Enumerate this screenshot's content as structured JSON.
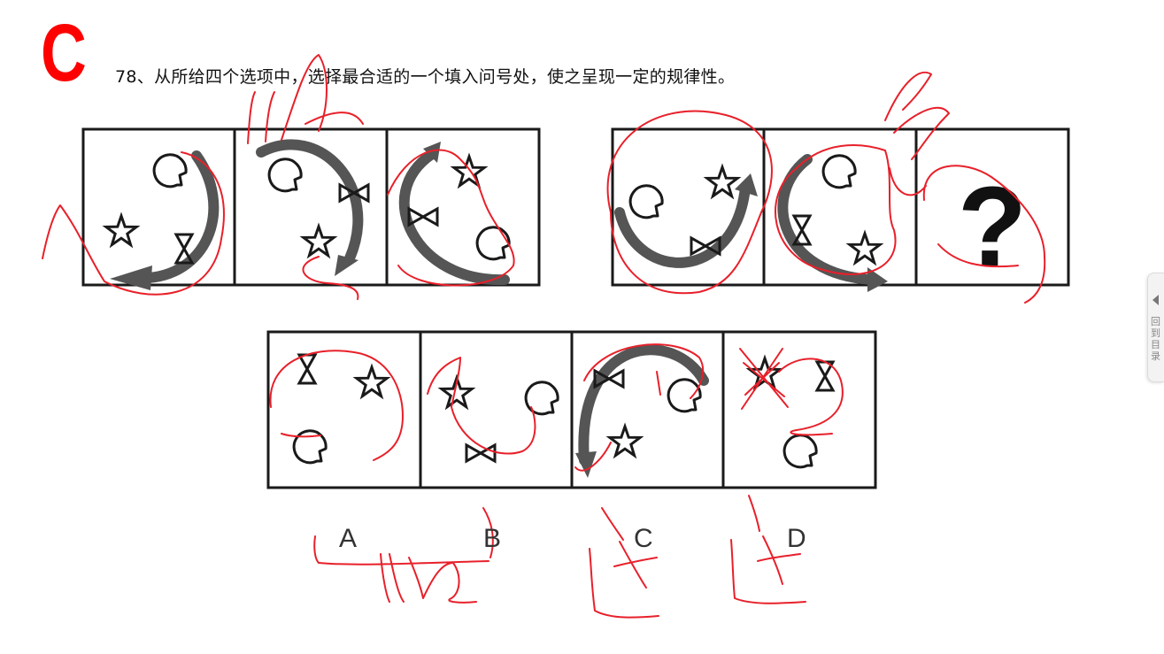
{
  "answer_mark": "C",
  "question_text": "78、从所给四个选项中，选择最合适的一个填入问号处，使之呈现一定的规律性。",
  "question_mark": "?",
  "options": [
    "A",
    "B",
    "C",
    "D"
  ],
  "side_tab": {
    "label": "回到目录"
  },
  "colors": {
    "annotation": "#e8202a",
    "line": "#1a1a1a",
    "arrow": "#555555",
    "answer": "#ff0000"
  },
  "icons": [
    "circle-hook",
    "star",
    "bowtie",
    "curved-arrow"
  ]
}
